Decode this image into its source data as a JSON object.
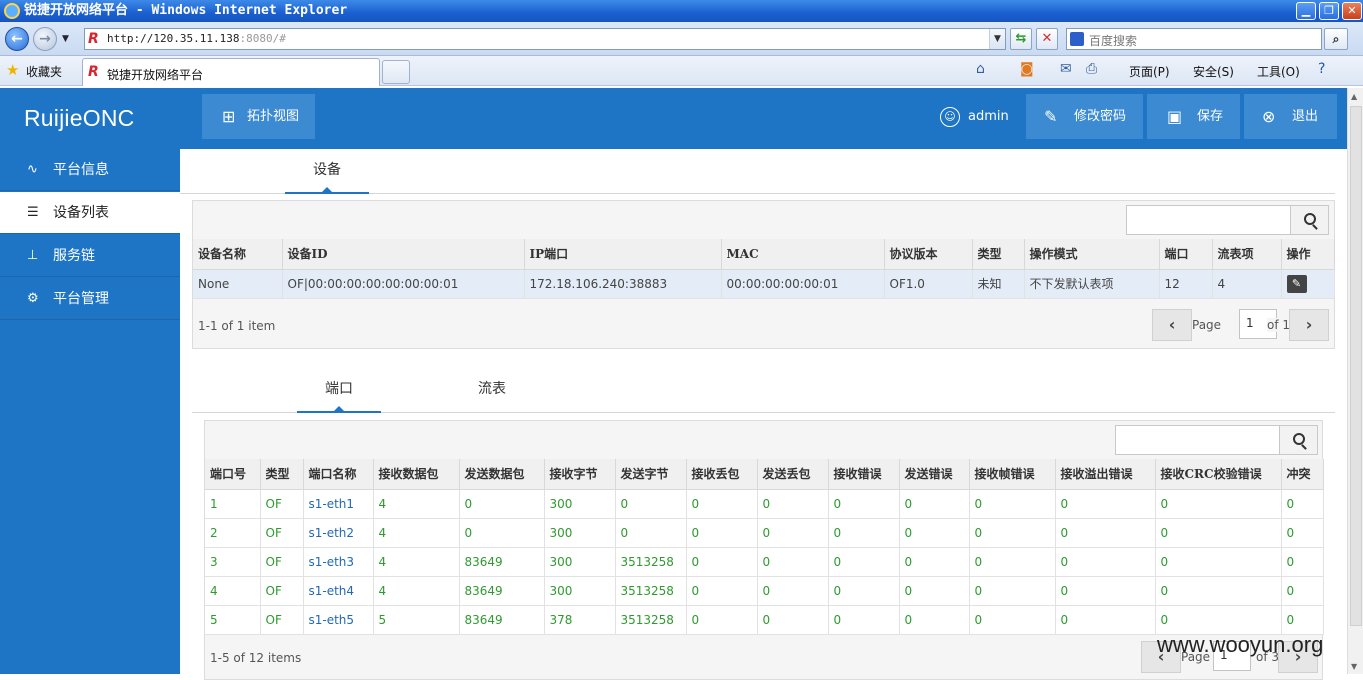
{
  "browser": {
    "window_title": "锐捷开放网络平台 - Windows Internet Explorer",
    "url_host": "http://120.35.11.138",
    "url_rest": ":8080/#",
    "search_placeholder": "百度搜索",
    "favorites_label": "收藏夹",
    "tab_title": "锐捷开放网络平台",
    "cmd_page": "页面(P)",
    "cmd_safety": "安全(S)",
    "cmd_tools": "工具(O)"
  },
  "app": {
    "brand": "RuijieONC",
    "topology_button": "拓扑视图",
    "user": "admin",
    "change_password": "修改密码",
    "save": "保存",
    "logout": "退出"
  },
  "sidebar": {
    "items": [
      {
        "label": "平台信息",
        "icon": "activity-icon"
      },
      {
        "label": "设备列表",
        "icon": "list-icon"
      },
      {
        "label": "服务链",
        "icon": "hierarchy-icon"
      },
      {
        "label": "平台管理",
        "icon": "gear-icon"
      }
    ]
  },
  "devices": {
    "tab": "设备",
    "search_value": "",
    "columns": [
      "设备名称",
      "设备ID",
      "IP端口",
      "MAC",
      "协议版本",
      "类型",
      "操作模式",
      "端口",
      "流表项",
      "操作"
    ],
    "rows": [
      [
        "None",
        "OF|00:00:00:00:00:00:00:01",
        "172.18.106.240:38883",
        "00:00:00:00:00:01",
        "OF1.0",
        "未知",
        "不下发默认表项",
        "12",
        "4"
      ]
    ],
    "summary": "1-1 of 1 item",
    "page_label": "Page",
    "page_value": "1",
    "page_of": "of 1"
  },
  "ports": {
    "tabs": [
      "端口",
      "流表"
    ],
    "search_value": "",
    "columns": [
      "端口号",
      "类型",
      "端口名称",
      "接收数据包",
      "发送数据包",
      "接收字节",
      "发送字节",
      "接收丢包",
      "发送丢包",
      "接收错误",
      "发送错误",
      "接收帧错误",
      "接收溢出错误",
      "接收CRC校验错误",
      "冲突"
    ],
    "rows": [
      [
        "1",
        "OF",
        "s1-eth1",
        "4",
        "0",
        "300",
        "0",
        "0",
        "0",
        "0",
        "0",
        "0",
        "0",
        "0",
        "0"
      ],
      [
        "2",
        "OF",
        "s1-eth2",
        "4",
        "0",
        "300",
        "0",
        "0",
        "0",
        "0",
        "0",
        "0",
        "0",
        "0",
        "0"
      ],
      [
        "3",
        "OF",
        "s1-eth3",
        "4",
        "83649",
        "300",
        "3513258",
        "0",
        "0",
        "0",
        "0",
        "0",
        "0",
        "0",
        "0"
      ],
      [
        "4",
        "OF",
        "s1-eth4",
        "4",
        "83649",
        "300",
        "3513258",
        "0",
        "0",
        "0",
        "0",
        "0",
        "0",
        "0",
        "0"
      ],
      [
        "5",
        "OF",
        "s1-eth5",
        "5",
        "83649",
        "378",
        "3513258",
        "0",
        "0",
        "0",
        "0",
        "0",
        "0",
        "0",
        "0"
      ]
    ],
    "summary": "1-5 of 12 items",
    "page_label": "Page",
    "page_value": "1",
    "page_of": "of 3"
  },
  "watermark": "www.wooyun.org",
  "colors": {
    "header": "#1e75c6",
    "accent": "#1e75c6",
    "port_value": "#2f9a2f",
    "port_name": "#1f69b6"
  }
}
